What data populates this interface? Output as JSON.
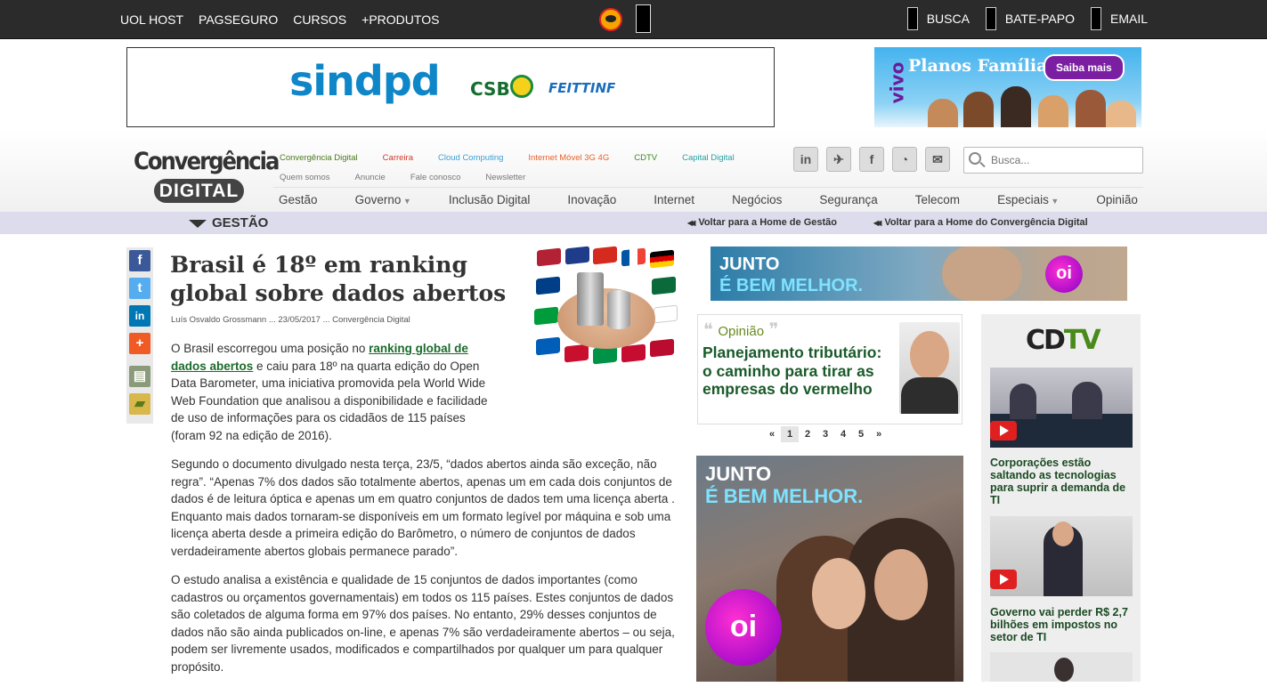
{
  "topbar": {
    "left_links": [
      "UOL HOST",
      "PAGSEGURO",
      "CURSOS",
      "+PRODUTOS"
    ],
    "right_links": [
      "BUSCA",
      "BATE-PAPO",
      "EMAIL"
    ]
  },
  "ads": {
    "left_banner": {
      "brand": "sindpd",
      "partner1": "CSB",
      "partner2": "FEITTINF"
    },
    "right_banner": {
      "brand": "vivo",
      "headline": "Planos Família",
      "button": "Saiba mais"
    },
    "oi_slogan_line1": "JUNTO",
    "oi_slogan_line2": "É BEM MELHOR.",
    "oi_brand": "oi"
  },
  "header": {
    "logo_line1": "Convergência",
    "logo_line2": "DIGITAL",
    "subnav": [
      {
        "label": "Convergência Digital",
        "color": "#4a7a1c"
      },
      {
        "label": "Carreira",
        "color": "#d0392b"
      },
      {
        "label": "Cloud Computing",
        "color": "#3aa0d8"
      },
      {
        "label": "Internet Móvel 3G 4G",
        "color": "#e8622c"
      },
      {
        "label": "CDTV",
        "color": "#3a8a1c"
      },
      {
        "label": "Capital Digital",
        "color": "#2aa0a0"
      }
    ],
    "subnav2": [
      "Quem somos",
      "Anuncie",
      "Fale conosco",
      "Newsletter"
    ],
    "social_icons": [
      "linkedin-icon",
      "twitter-icon",
      "facebook-icon",
      "rss-icon",
      "email-icon"
    ],
    "search_placeholder": "Busca...",
    "mainnav": [
      "Gestão",
      "Governo",
      "Inclusão Digital",
      "Inovação",
      "Internet",
      "Negócios",
      "Segurança",
      "Telecom",
      "Especiais",
      "Opinião"
    ]
  },
  "section": {
    "title": "GESTÃO",
    "back_section": "Voltar para a Home de Gestão",
    "back_home": "Voltar para a Home do Convergência Digital"
  },
  "share": [
    "facebook-icon",
    "twitter-icon",
    "linkedin-icon",
    "plus-icon",
    "print-icon",
    "folder-icon"
  ],
  "article": {
    "title": "Brasil é 18º em ranking global sobre dados abertos",
    "meta": "Luís Osvaldo Grossmann ... 23/05/2017 ... Convergência Digital",
    "p1_before": "O Brasil escorregou uma posição no ",
    "p1_link": "ranking global de dados abertos",
    "p1_after": " e caiu para 18º na quarta edição do Open Data Barometer, uma iniciativa promovida pela World Wide Web Foundation que analisou a disponibilidade e facilidade de uso de informações para os cidadãos de 115 países (foram 92 na edição de 2016).",
    "p2": "Segundo o documento divulgado nesta terça, 23/5,  “dados abertos ainda são exceção, não regra”. “Apenas 7% dos dados são totalmente abertos, apenas um em cada dois conjuntos de dados é de leitura óptica e apenas um em quatro conjuntos de dados tem uma licença aberta . Enquanto mais dados tornaram-se disponíveis em um formato legível por máquina e sob uma licença aberta desde a primeira edição do Barômetro, o número de conjuntos de dados verdadeiramente abertos globais permanece parado”.",
    "p3": "O estudo analisa a existência e qualidade de 15 conjuntos de dados importantes (como cadastros ou orçamentos governamentais) em todos os 115 países. Estes conjuntos de dados são coletados de alguma forma em 97% dos países. No entanto, 29% desses conjuntos de dados não são ainda publicados on-line, e apenas 7% são verdadeiramente abertos – ou seja, podem ser livremente usados, modificados e compartilhados por qualquer um para qualquer propósito."
  },
  "opinion": {
    "label": "Opinião",
    "headline": "Planejamento tributário: o caminho para tirar as empresas do vermelho",
    "pages": [
      "«",
      "1",
      "2",
      "3",
      "4",
      "5",
      "»"
    ],
    "current_page": "1"
  },
  "cdtv": {
    "logo_cd": "CD",
    "logo_tv": "TV",
    "items": [
      {
        "caption": "Corporações estão saltando as tecnologias para suprir a demanda de TI"
      },
      {
        "caption": "Governo vai perder R$ 2,7 bilhões em impostos no setor de TI"
      }
    ]
  }
}
